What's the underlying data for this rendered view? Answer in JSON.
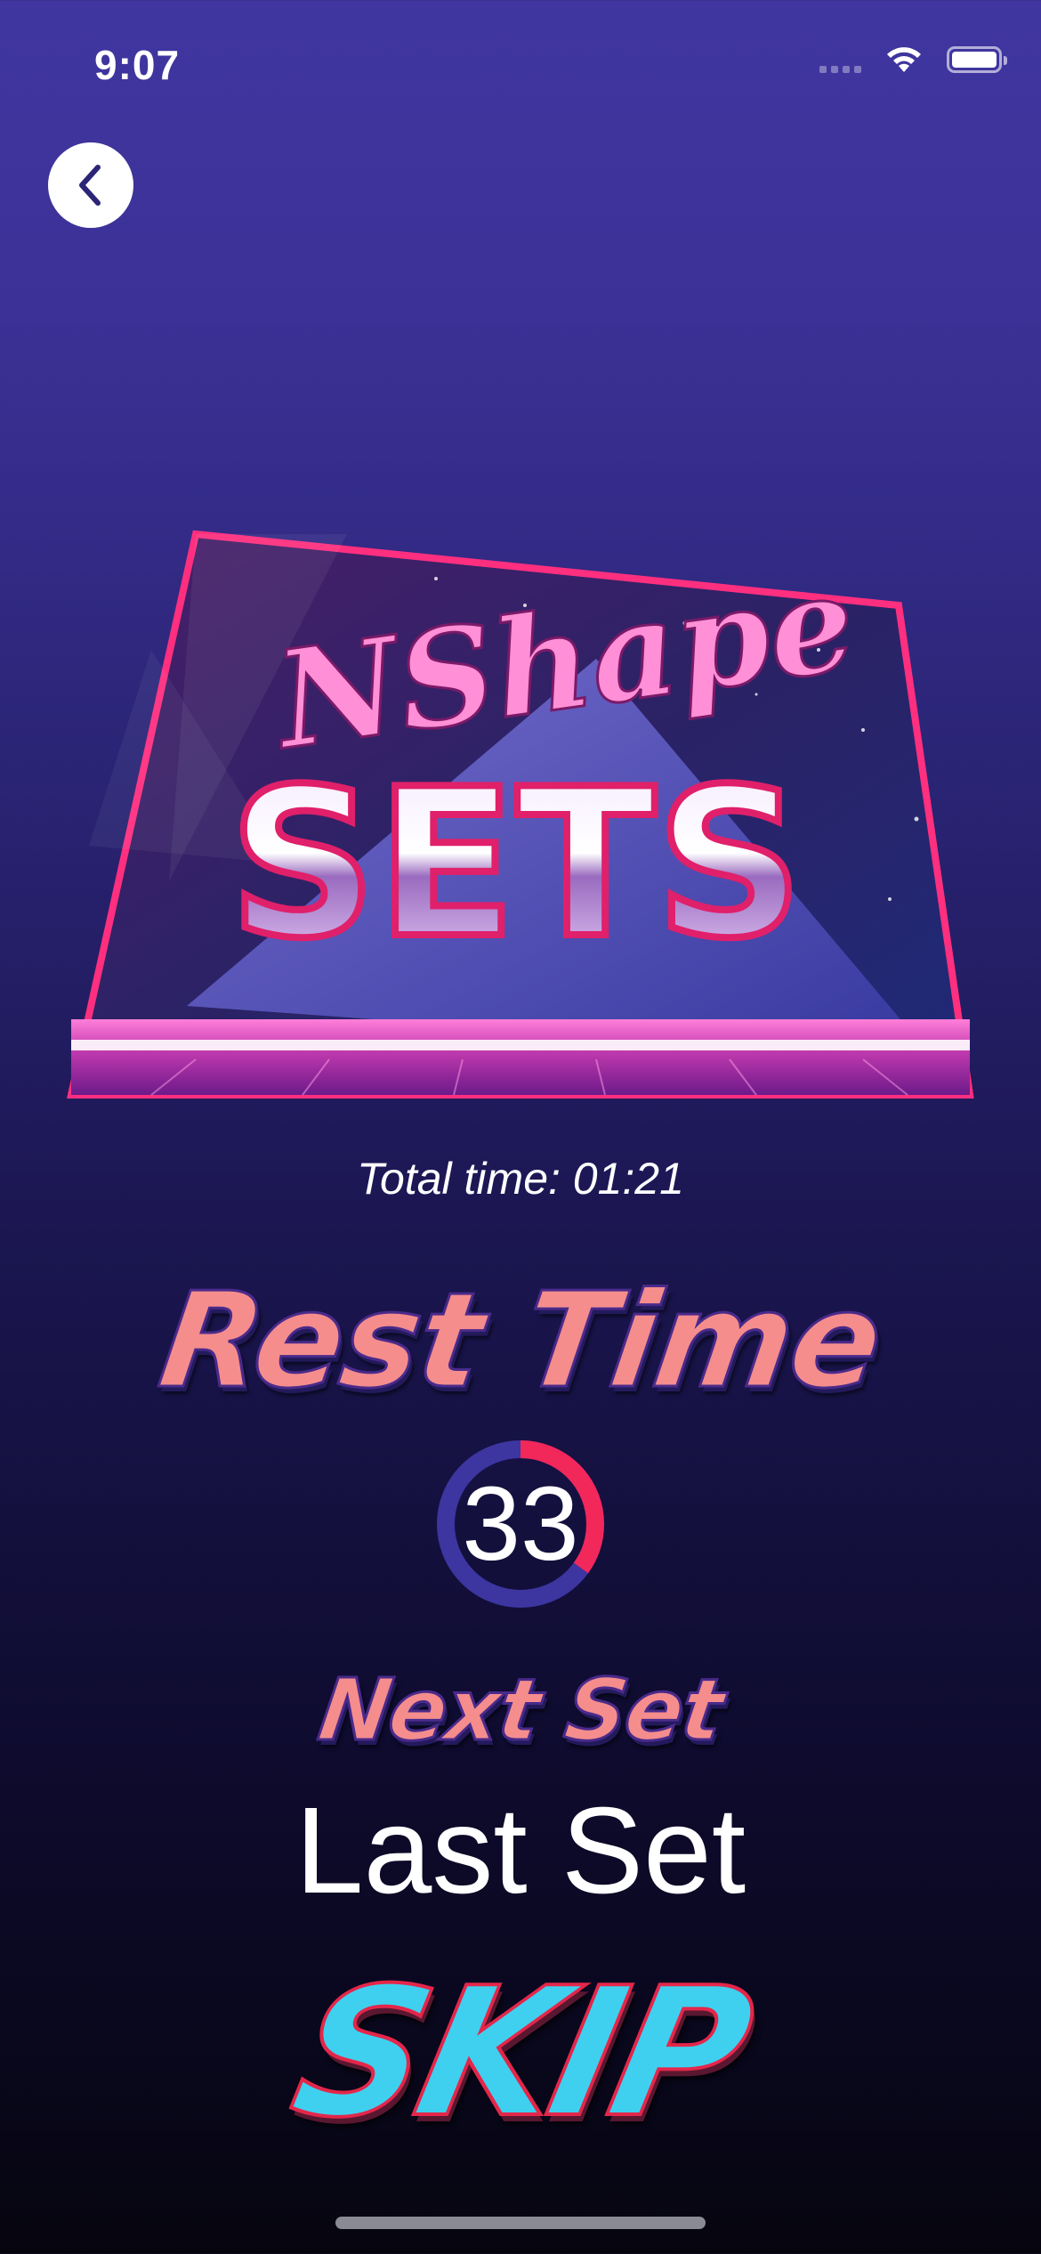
{
  "status_bar": {
    "time": "9:07"
  },
  "banner": {
    "script_text": "NShape",
    "main_text": "SETS"
  },
  "total_time": "Total time: 01:21",
  "rest": {
    "title": "Rest Time",
    "seconds": "33",
    "progress": 0.35
  },
  "next": {
    "title": "Next Set",
    "value": "Last Set"
  },
  "skip": {
    "label": "SKIP"
  },
  "colors": {
    "accent": "#f58d8d",
    "ring_track": "#3d35a0",
    "ring_progress": "#f2275a",
    "skip": "#3fd0ef"
  }
}
